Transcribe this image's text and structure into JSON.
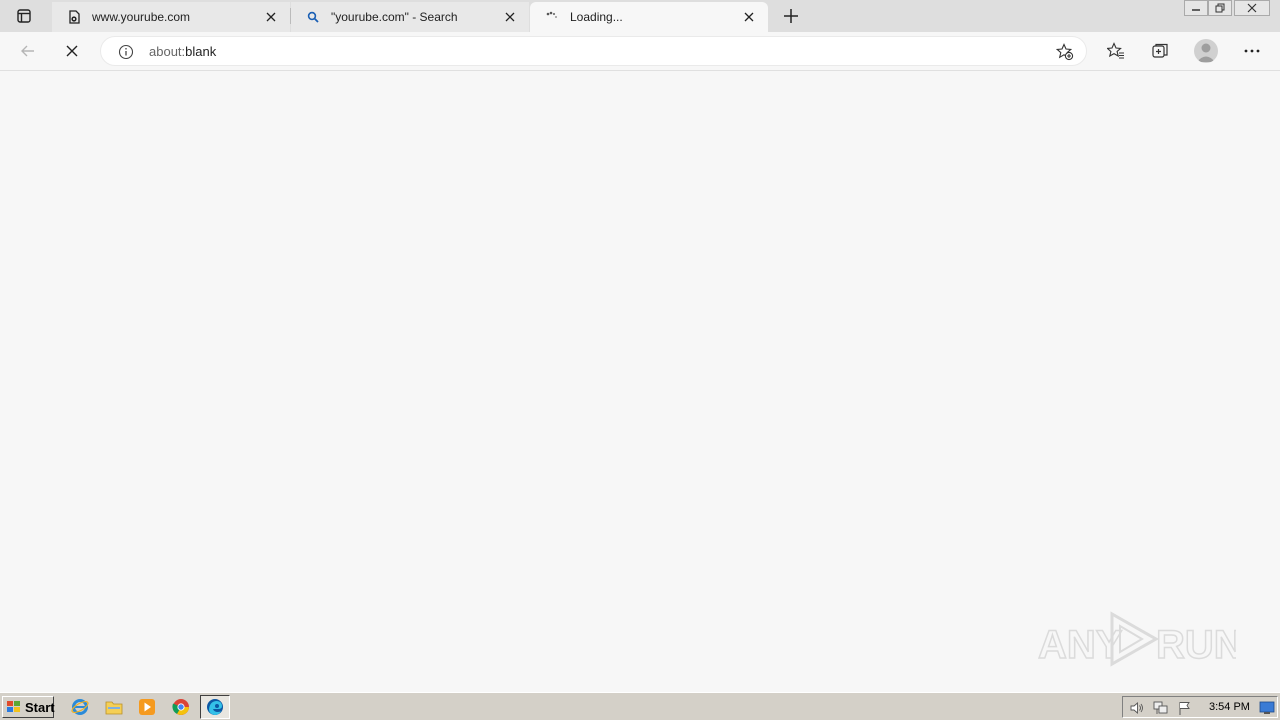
{
  "tabs": [
    {
      "title": "www.yourube.com",
      "favicon": "document-lock-icon",
      "state": "inactive"
    },
    {
      "title": "\"yourube.com\" - Search",
      "favicon": "search-icon",
      "state": "inactive"
    },
    {
      "title": "Loading...",
      "favicon": "loading-spinner-icon",
      "state": "active"
    }
  ],
  "address_bar": {
    "scheme": "about:",
    "path": "blank"
  },
  "taskbar": {
    "start_label": "Start",
    "apps": [
      "internet-explorer-icon",
      "file-explorer-icon",
      "media-player-icon",
      "chrome-icon",
      "edge-icon"
    ],
    "clock": "3:54 PM"
  },
  "colors": {
    "accent": "#0078d4",
    "tab_bar": "#dedede",
    "page_bg": "#f7f7f7",
    "taskbar": "#d4d0c8"
  }
}
